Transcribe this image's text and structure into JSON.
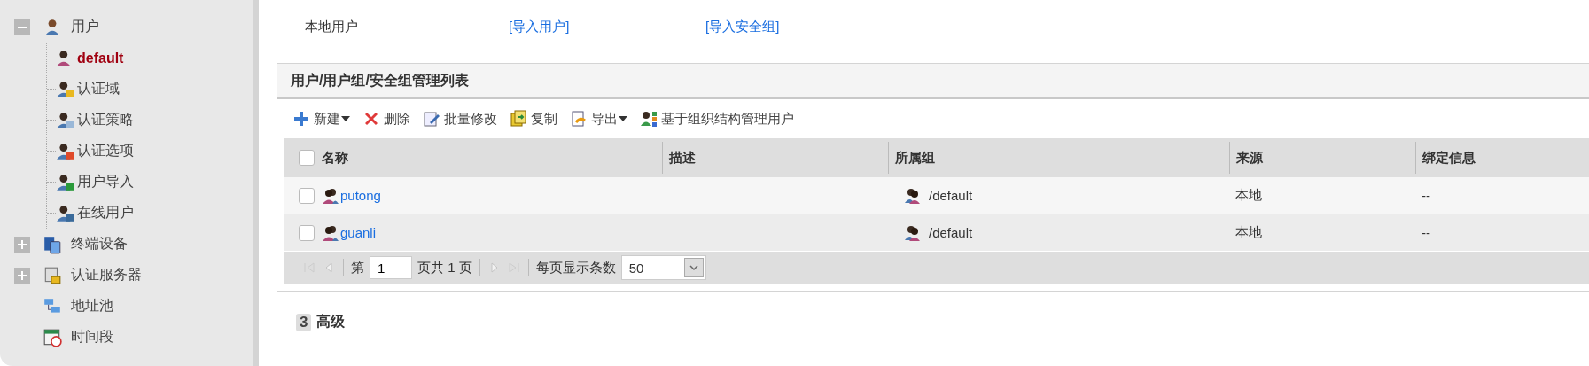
{
  "sidebar": {
    "items": [
      {
        "label": "用户",
        "kind": "group",
        "expanded": true,
        "children": [
          {
            "label": "default",
            "selected": true
          },
          {
            "label": "认证域",
            "selected": false
          },
          {
            "label": "认证策略",
            "selected": false
          },
          {
            "label": "认证选项",
            "selected": false
          },
          {
            "label": "用户导入",
            "selected": false
          },
          {
            "label": "在线用户",
            "selected": false
          }
        ]
      },
      {
        "label": "终端设备",
        "kind": "group",
        "expanded": false
      },
      {
        "label": "认证服务器",
        "kind": "group",
        "expanded": false
      },
      {
        "label": "地址池",
        "kind": "leaf"
      },
      {
        "label": "时间段",
        "kind": "leaf"
      }
    ]
  },
  "local_users": {
    "label": "本地用户",
    "links": [
      "[导入用户]",
      "[导入安全组]"
    ]
  },
  "panel": {
    "title": "用户/用户组/安全组管理列表",
    "toolbar": [
      {
        "label": "新建",
        "dropdown": true
      },
      {
        "label": "删除",
        "dropdown": false
      },
      {
        "label": "批量修改",
        "dropdown": false
      },
      {
        "label": "复制",
        "dropdown": false
      },
      {
        "label": "导出",
        "dropdown": true
      },
      {
        "label": "基于组织结构管理用户",
        "dropdown": false
      }
    ],
    "table": {
      "select_all": {
        "checked": false
      },
      "columns": [
        "名称",
        "描述",
        "所属组",
        "来源",
        "绑定信息"
      ],
      "rows": [
        {
          "checked": false,
          "name": "putong",
          "group": "/default",
          "source": "本地",
          "binding": "--"
        },
        {
          "checked": false,
          "name": "guanli",
          "group": "/default",
          "source": "本地",
          "binding": "--"
        }
      ]
    },
    "pager": {
      "page_label": "第",
      "page": "1",
      "total": "页共 1 页",
      "page_size_label": "每页显示条数",
      "page_size": "50"
    }
  },
  "section": {
    "number": "3",
    "title": "高级"
  }
}
